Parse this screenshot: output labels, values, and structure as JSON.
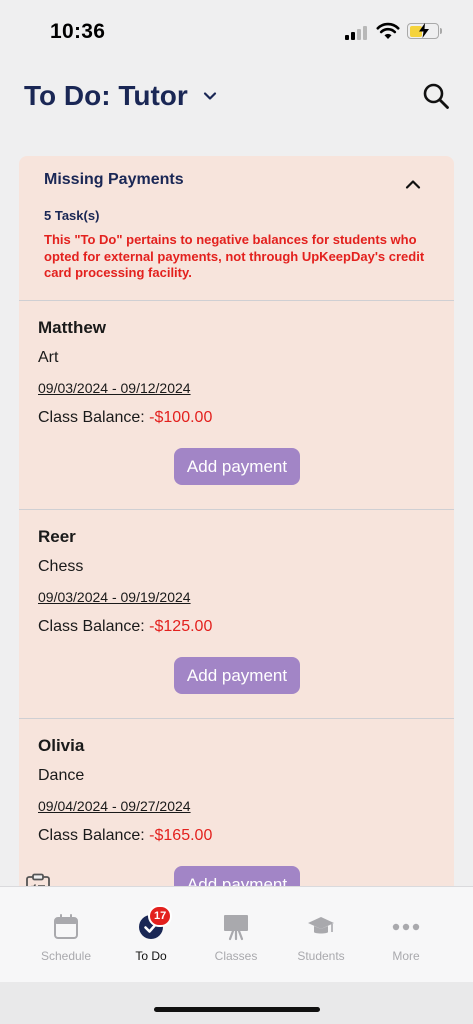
{
  "status": {
    "time": "10:36"
  },
  "header": {
    "title": "To Do: Tutor"
  },
  "section": {
    "title": "Missing Payments",
    "task_count": "5 Task(s)",
    "note": "This \"To Do\" pertains to negative balances for students who opted for external payments, not through UpKeepDay's credit card processing facility."
  },
  "balance_label": "Class Balance:",
  "button_label": "Add payment",
  "students": [
    {
      "name": "Matthew",
      "class": "Art",
      "dates": "09/03/2024 - 09/12/2024",
      "balance": "-$100.00"
    },
    {
      "name": "Reer",
      "class": "Chess",
      "dates": "09/03/2024 - 09/19/2024",
      "balance": "-$125.00"
    },
    {
      "name": "Olivia",
      "class": "Dance",
      "dates": "09/04/2024 - 09/27/2024",
      "balance": "-$165.00"
    }
  ],
  "tabs": [
    {
      "label": "Schedule",
      "icon": "calendar-icon"
    },
    {
      "label": "To Do",
      "icon": "check-circle-icon",
      "badge": "17"
    },
    {
      "label": "Classes",
      "icon": "easel-icon"
    },
    {
      "label": "Students",
      "icon": "graduation-cap-icon"
    },
    {
      "label": "More",
      "icon": "more-icon"
    }
  ],
  "colors": {
    "accent": "#a285c6",
    "title": "#1a2755",
    "negative": "#e3211e",
    "card": "#f7e4dc"
  }
}
